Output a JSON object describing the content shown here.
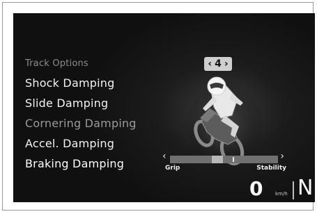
{
  "menu": {
    "header": "Track Options",
    "items": [
      {
        "label": "Shock Damping"
      },
      {
        "label": "Slide Damping"
      },
      {
        "label": "Cornering Damping"
      },
      {
        "label": "Accel. Damping"
      },
      {
        "label": "Braking Damping"
      }
    ]
  },
  "page_indicator": {
    "prev": "‹",
    "value": "4",
    "next": "›"
  },
  "slider": {
    "left_arrow": "‹",
    "right_arrow": "›",
    "left_label": "Grip",
    "right_label": "Stability",
    "value_fraction": 0.43
  },
  "status": {
    "speed": "0",
    "speed_unit": "km/h",
    "gear": "N"
  },
  "colors": {
    "background": "#101010",
    "text": "#f2f2f2",
    "dim_text": "#8c8c8c",
    "accent": "#cfcfcf"
  }
}
